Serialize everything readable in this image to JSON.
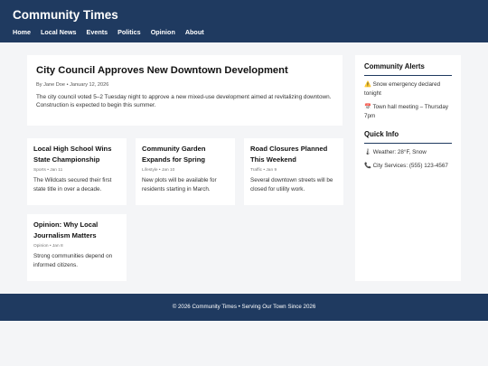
{
  "header": {
    "brand": "Community Times",
    "nav": [
      "Home",
      "Local News",
      "Events",
      "Politics",
      "Opinion",
      "About"
    ]
  },
  "featured": {
    "title": "City Council Approves New Downtown Development",
    "meta": "By Jane Doe • January 12, 2026",
    "body": "The city council voted 5–2 Tuesday night to approve a new mixed-use development aimed at revitalizing downtown. Construction is expected to begin this summer."
  },
  "articles": [
    {
      "title": "Local High School Wins State Championship",
      "tag": "Sports • Jan 11",
      "body": "The Wildcats secured their first state title in over a decade."
    },
    {
      "title": "Community Garden Expands for Spring",
      "tag": "Lifestyle • Jan 10",
      "body": "New plots will be available for residents starting in March."
    },
    {
      "title": "Road Closures Planned This Weekend",
      "tag": "Traffic • Jan 9",
      "body": "Several downtown streets will be closed for utility work."
    },
    {
      "title": "Opinion: Why Local Journalism Matters",
      "tag": "Opinion • Jan 8",
      "body": "Strong communities depend on informed citizens."
    }
  ],
  "sidebar": {
    "alerts_title": "Community Alerts",
    "alerts": [
      {
        "icon": "⚠️",
        "text": "Snow emergency declared tonight"
      },
      {
        "icon": "📅",
        "text": "Town hall meeting – Thursday 7pm"
      }
    ],
    "info_title": "Quick Info",
    "info": [
      {
        "icon": "🌡",
        "text": "Weather: 28°F, Snow"
      },
      {
        "icon": "📞",
        "text": "City Services: (555) 123-4567"
      }
    ]
  },
  "footer": {
    "text": "© 2026 Community Times • Serving Our Town Since 2026"
  },
  "colors": {
    "brand_navy": "#1f3a60",
    "page_bg": "#f4f5f7"
  }
}
